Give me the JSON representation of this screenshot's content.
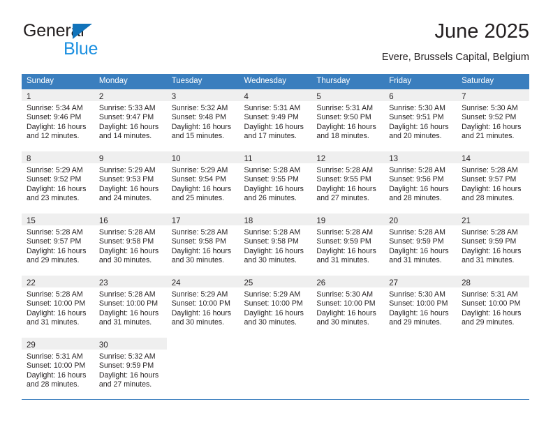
{
  "brand": {
    "name_top": "General",
    "name_bottom": "Blue",
    "accent_color": "#1173ba",
    "accent_color_light": "#1a8fe0"
  },
  "header": {
    "title": "June 2025",
    "subtitle": "Evere, Brussels Capital, Belgium",
    "header_bg": "#3a7ebe",
    "header_text_color": "#ffffff",
    "daynum_band_bg": "#efefef"
  },
  "weekday_headers": [
    "Sunday",
    "Monday",
    "Tuesday",
    "Wednesday",
    "Thursday",
    "Friday",
    "Saturday"
  ],
  "weeks": [
    [
      {
        "day": "1",
        "sunrise": "Sunrise: 5:34 AM",
        "sunset": "Sunset: 9:46 PM",
        "daylight1": "Daylight: 16 hours",
        "daylight2": "and 12 minutes."
      },
      {
        "day": "2",
        "sunrise": "Sunrise: 5:33 AM",
        "sunset": "Sunset: 9:47 PM",
        "daylight1": "Daylight: 16 hours",
        "daylight2": "and 14 minutes."
      },
      {
        "day": "3",
        "sunrise": "Sunrise: 5:32 AM",
        "sunset": "Sunset: 9:48 PM",
        "daylight1": "Daylight: 16 hours",
        "daylight2": "and 15 minutes."
      },
      {
        "day": "4",
        "sunrise": "Sunrise: 5:31 AM",
        "sunset": "Sunset: 9:49 PM",
        "daylight1": "Daylight: 16 hours",
        "daylight2": "and 17 minutes."
      },
      {
        "day": "5",
        "sunrise": "Sunrise: 5:31 AM",
        "sunset": "Sunset: 9:50 PM",
        "daylight1": "Daylight: 16 hours",
        "daylight2": "and 18 minutes."
      },
      {
        "day": "6",
        "sunrise": "Sunrise: 5:30 AM",
        "sunset": "Sunset: 9:51 PM",
        "daylight1": "Daylight: 16 hours",
        "daylight2": "and 20 minutes."
      },
      {
        "day": "7",
        "sunrise": "Sunrise: 5:30 AM",
        "sunset": "Sunset: 9:52 PM",
        "daylight1": "Daylight: 16 hours",
        "daylight2": "and 21 minutes."
      }
    ],
    [
      {
        "day": "8",
        "sunrise": "Sunrise: 5:29 AM",
        "sunset": "Sunset: 9:52 PM",
        "daylight1": "Daylight: 16 hours",
        "daylight2": "and 23 minutes."
      },
      {
        "day": "9",
        "sunrise": "Sunrise: 5:29 AM",
        "sunset": "Sunset: 9:53 PM",
        "daylight1": "Daylight: 16 hours",
        "daylight2": "and 24 minutes."
      },
      {
        "day": "10",
        "sunrise": "Sunrise: 5:29 AM",
        "sunset": "Sunset: 9:54 PM",
        "daylight1": "Daylight: 16 hours",
        "daylight2": "and 25 minutes."
      },
      {
        "day": "11",
        "sunrise": "Sunrise: 5:28 AM",
        "sunset": "Sunset: 9:55 PM",
        "daylight1": "Daylight: 16 hours",
        "daylight2": "and 26 minutes."
      },
      {
        "day": "12",
        "sunrise": "Sunrise: 5:28 AM",
        "sunset": "Sunset: 9:55 PM",
        "daylight1": "Daylight: 16 hours",
        "daylight2": "and 27 minutes."
      },
      {
        "day": "13",
        "sunrise": "Sunrise: 5:28 AM",
        "sunset": "Sunset: 9:56 PM",
        "daylight1": "Daylight: 16 hours",
        "daylight2": "and 28 minutes."
      },
      {
        "day": "14",
        "sunrise": "Sunrise: 5:28 AM",
        "sunset": "Sunset: 9:57 PM",
        "daylight1": "Daylight: 16 hours",
        "daylight2": "and 28 minutes."
      }
    ],
    [
      {
        "day": "15",
        "sunrise": "Sunrise: 5:28 AM",
        "sunset": "Sunset: 9:57 PM",
        "daylight1": "Daylight: 16 hours",
        "daylight2": "and 29 minutes."
      },
      {
        "day": "16",
        "sunrise": "Sunrise: 5:28 AM",
        "sunset": "Sunset: 9:58 PM",
        "daylight1": "Daylight: 16 hours",
        "daylight2": "and 30 minutes."
      },
      {
        "day": "17",
        "sunrise": "Sunrise: 5:28 AM",
        "sunset": "Sunset: 9:58 PM",
        "daylight1": "Daylight: 16 hours",
        "daylight2": "and 30 minutes."
      },
      {
        "day": "18",
        "sunrise": "Sunrise: 5:28 AM",
        "sunset": "Sunset: 9:58 PM",
        "daylight1": "Daylight: 16 hours",
        "daylight2": "and 30 minutes."
      },
      {
        "day": "19",
        "sunrise": "Sunrise: 5:28 AM",
        "sunset": "Sunset: 9:59 PM",
        "daylight1": "Daylight: 16 hours",
        "daylight2": "and 31 minutes."
      },
      {
        "day": "20",
        "sunrise": "Sunrise: 5:28 AM",
        "sunset": "Sunset: 9:59 PM",
        "daylight1": "Daylight: 16 hours",
        "daylight2": "and 31 minutes."
      },
      {
        "day": "21",
        "sunrise": "Sunrise: 5:28 AM",
        "sunset": "Sunset: 9:59 PM",
        "daylight1": "Daylight: 16 hours",
        "daylight2": "and 31 minutes."
      }
    ],
    [
      {
        "day": "22",
        "sunrise": "Sunrise: 5:28 AM",
        "sunset": "Sunset: 10:00 PM",
        "daylight1": "Daylight: 16 hours",
        "daylight2": "and 31 minutes."
      },
      {
        "day": "23",
        "sunrise": "Sunrise: 5:28 AM",
        "sunset": "Sunset: 10:00 PM",
        "daylight1": "Daylight: 16 hours",
        "daylight2": "and 31 minutes."
      },
      {
        "day": "24",
        "sunrise": "Sunrise: 5:29 AM",
        "sunset": "Sunset: 10:00 PM",
        "daylight1": "Daylight: 16 hours",
        "daylight2": "and 30 minutes."
      },
      {
        "day": "25",
        "sunrise": "Sunrise: 5:29 AM",
        "sunset": "Sunset: 10:00 PM",
        "daylight1": "Daylight: 16 hours",
        "daylight2": "and 30 minutes."
      },
      {
        "day": "26",
        "sunrise": "Sunrise: 5:30 AM",
        "sunset": "Sunset: 10:00 PM",
        "daylight1": "Daylight: 16 hours",
        "daylight2": "and 30 minutes."
      },
      {
        "day": "27",
        "sunrise": "Sunrise: 5:30 AM",
        "sunset": "Sunset: 10:00 PM",
        "daylight1": "Daylight: 16 hours",
        "daylight2": "and 29 minutes."
      },
      {
        "day": "28",
        "sunrise": "Sunrise: 5:31 AM",
        "sunset": "Sunset: 10:00 PM",
        "daylight1": "Daylight: 16 hours",
        "daylight2": "and 29 minutes."
      }
    ],
    [
      {
        "day": "29",
        "sunrise": "Sunrise: 5:31 AM",
        "sunset": "Sunset: 10:00 PM",
        "daylight1": "Daylight: 16 hours",
        "daylight2": "and 28 minutes."
      },
      {
        "day": "30",
        "sunrise": "Sunrise: 5:32 AM",
        "sunset": "Sunset: 9:59 PM",
        "daylight1": "Daylight: 16 hours",
        "daylight2": "and 27 minutes."
      },
      {
        "day": "",
        "sunrise": "",
        "sunset": "",
        "daylight1": "",
        "daylight2": ""
      },
      {
        "day": "",
        "sunrise": "",
        "sunset": "",
        "daylight1": "",
        "daylight2": ""
      },
      {
        "day": "",
        "sunrise": "",
        "sunset": "",
        "daylight1": "",
        "daylight2": ""
      },
      {
        "day": "",
        "sunrise": "",
        "sunset": "",
        "daylight1": "",
        "daylight2": ""
      },
      {
        "day": "",
        "sunrise": "",
        "sunset": "",
        "daylight1": "",
        "daylight2": ""
      }
    ]
  ]
}
